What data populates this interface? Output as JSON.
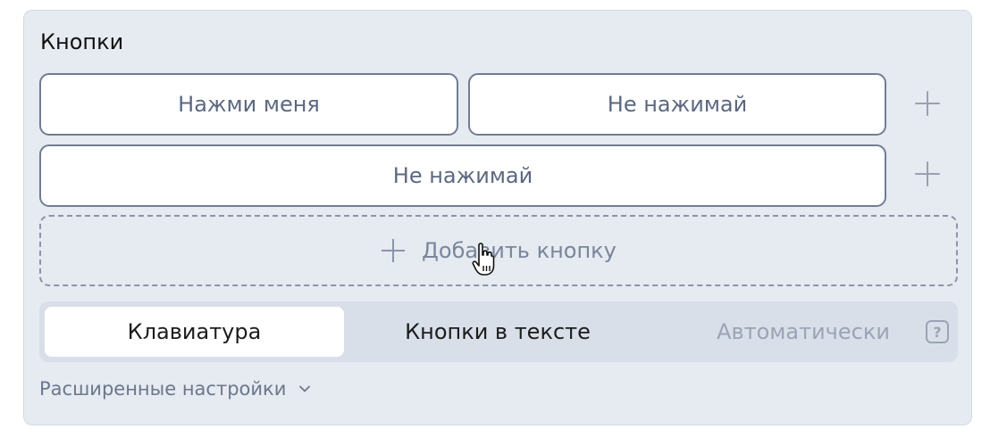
{
  "section": {
    "title": "Кнопки"
  },
  "rows": [
    {
      "buttons": [
        "Нажми меня",
        "Не нажимай"
      ]
    },
    {
      "buttons": [
        "Не нажимай"
      ]
    }
  ],
  "add_button": {
    "label": "Добавить кнопку",
    "icon": "plus-icon"
  },
  "keyboard_type": {
    "options": [
      "Клавиатура",
      "Кнопки в тексте",
      "Автоматически"
    ],
    "selected": "Клавиатура",
    "disabled": [
      "Автоматически"
    ],
    "help_icon": "question-icon",
    "help_glyph": "?"
  },
  "advanced": {
    "label": "Расширенные настройки",
    "icon": "chevron-down-icon"
  },
  "colors": {
    "panel_bg": "#e6eaf1",
    "button_border": "#727d93",
    "button_text": "#5c6880",
    "muted": "#9aa4b6"
  }
}
